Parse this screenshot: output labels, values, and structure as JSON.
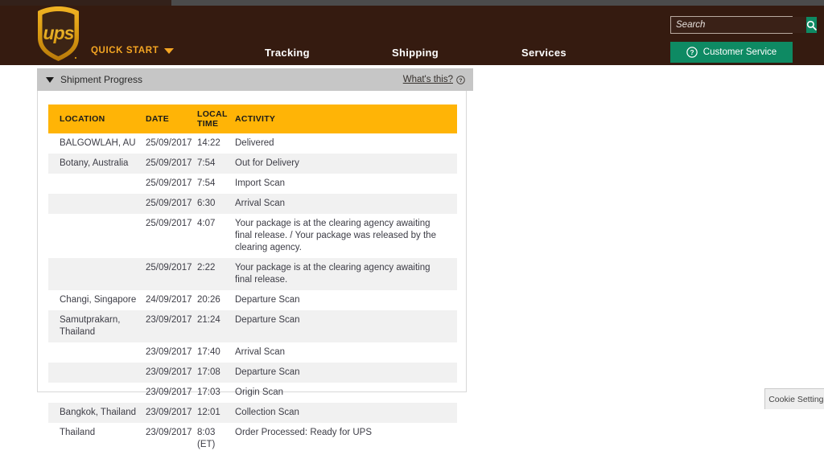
{
  "header": {
    "logo_alt": "UPS",
    "quick_start_label": "QUICK START",
    "nav": [
      {
        "label": "Tracking"
      },
      {
        "label": "Shipping"
      },
      {
        "label": "Services"
      }
    ],
    "search": {
      "placeholder": "Search",
      "value": "",
      "button_icon": "search-icon"
    },
    "customer_service": {
      "label": "Customer Service",
      "icon": "question-circle-icon"
    },
    "colors": {
      "header_bg": "#351b10",
      "brand_gold": "#f5a623",
      "accent_green": "#0e8a63"
    }
  },
  "shipment_progress": {
    "title": "Shipment Progress",
    "toggle_icon": "caret-down-icon",
    "whats_this_label": "What's this?",
    "whats_this_icon": "question-circle-icon"
  },
  "tracking_table": {
    "header_color": "#ffb406",
    "columns": [
      {
        "label": "LOCATION"
      },
      {
        "label": "DATE"
      },
      {
        "label_line1": "LOCAL",
        "label_line2": "TIME"
      },
      {
        "label": "ACTIVITY"
      }
    ],
    "rows": [
      {
        "location": "BALGOWLAH,  AU",
        "date": "25/09/2017",
        "time": "14:22",
        "activity": "Delivered"
      },
      {
        "location": "Botany,  Australia",
        "date": "25/09/2017",
        "time": "7:54",
        "activity": "Out for Delivery"
      },
      {
        "location": "",
        "date": "25/09/2017",
        "time": "7:54",
        "activity": "Import Scan"
      },
      {
        "location": "",
        "date": "25/09/2017",
        "time": "6:30",
        "activity": "Arrival Scan"
      },
      {
        "location": "",
        "date": "25/09/2017",
        "time": "4:07",
        "activity": "Your package is at the clearing agency awaiting final release. / Your package was released by the clearing agency."
      },
      {
        "location": "",
        "date": "25/09/2017",
        "time": "2:22",
        "activity": "Your package is at the clearing agency awaiting final release."
      },
      {
        "location": "Changi,  Singapore",
        "date": "24/09/2017",
        "time": "20:26",
        "activity": "Departure Scan"
      },
      {
        "location": "Samutprakarn,  Thailand",
        "date": "23/09/2017",
        "time": "21:24",
        "activity": "Departure Scan"
      },
      {
        "location": "",
        "date": "23/09/2017",
        "time": "17:40",
        "activity": "Arrival Scan"
      },
      {
        "location": "",
        "date": "23/09/2017",
        "time": "17:08",
        "activity": "Departure Scan"
      },
      {
        "location": "",
        "date": "23/09/2017",
        "time": "17:03",
        "activity": "Origin Scan"
      },
      {
        "location": "Bangkok,  Thailand",
        "date": "23/09/2017",
        "time": "12:01",
        "activity": "Collection Scan"
      },
      {
        "location": "Thailand",
        "date": "23/09/2017",
        "time": "8:03 (ET)",
        "activity": "Order Processed: Ready for UPS"
      }
    ]
  },
  "cookie_settings": {
    "label": "Cookie Settings"
  }
}
